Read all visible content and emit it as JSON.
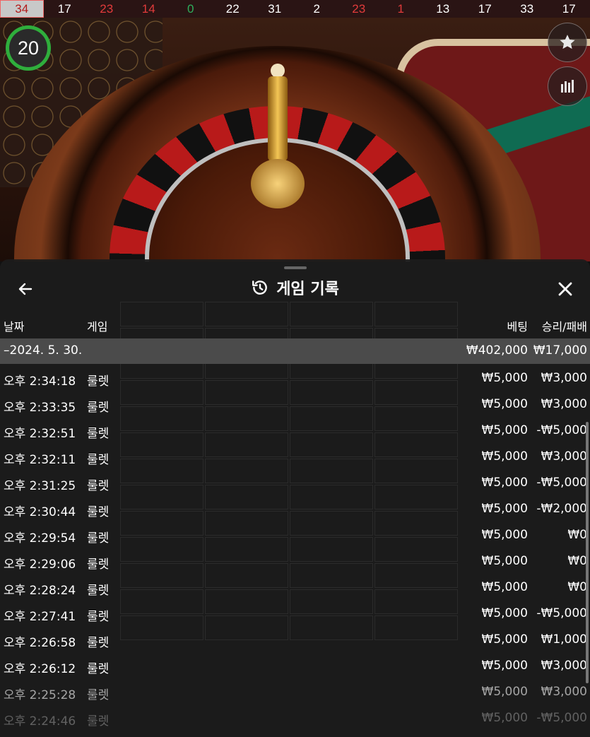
{
  "results_strip": [
    {
      "value": "34",
      "color": "#b31b1b",
      "highlight": true
    },
    {
      "value": "17",
      "color": "#ffffff"
    },
    {
      "value": "23",
      "color": "#e23b3b"
    },
    {
      "value": "14",
      "color": "#e23b3b"
    },
    {
      "value": "0",
      "color": "#2fae5c"
    },
    {
      "value": "22",
      "color": "#ffffff"
    },
    {
      "value": "31",
      "color": "#ffffff"
    },
    {
      "value": "2",
      "color": "#ffffff"
    },
    {
      "value": "23",
      "color": "#e23b3b"
    },
    {
      "value": "1",
      "color": "#e23b3b"
    },
    {
      "value": "13",
      "color": "#ffffff"
    },
    {
      "value": "17",
      "color": "#ffffff"
    },
    {
      "value": "33",
      "color": "#ffffff"
    },
    {
      "value": "17",
      "color": "#ffffff"
    }
  ],
  "timer": {
    "value": "20",
    "color": "#2fae3c"
  },
  "panel": {
    "title": "게임 기록",
    "back_icon": "arrow-left-icon",
    "history_icon": "history-icon",
    "close_icon": "close-icon"
  },
  "columns": {
    "date": "날짜",
    "game": "게임",
    "bet": "베팅",
    "win": "승리/패배"
  },
  "summary": {
    "date": "–2024. 5. 30.",
    "bet": "₩402,000",
    "win": "₩17,000"
  },
  "rows": [
    {
      "time": "오후 2:34:18",
      "game": "룰렛",
      "bet": "₩5,000",
      "win": "₩3,000"
    },
    {
      "time": "오후 2:33:35",
      "game": "룰렛",
      "bet": "₩5,000",
      "win": "₩3,000"
    },
    {
      "time": "오후 2:32:51",
      "game": "룰렛",
      "bet": "₩5,000",
      "win": "-₩5,000"
    },
    {
      "time": "오후 2:32:11",
      "game": "룰렛",
      "bet": "₩5,000",
      "win": "₩3,000"
    },
    {
      "time": "오후 2:31:25",
      "game": "룰렛",
      "bet": "₩5,000",
      "win": "-₩5,000"
    },
    {
      "time": "오후 2:30:44",
      "game": "룰렛",
      "bet": "₩5,000",
      "win": "-₩2,000"
    },
    {
      "time": "오후 2:29:54",
      "game": "룰렛",
      "bet": "₩5,000",
      "win": "₩0"
    },
    {
      "time": "오후 2:29:06",
      "game": "룰렛",
      "bet": "₩5,000",
      "win": "₩0"
    },
    {
      "time": "오후 2:28:24",
      "game": "룰렛",
      "bet": "₩5,000",
      "win": "₩0"
    },
    {
      "time": "오후 2:27:41",
      "game": "룰렛",
      "bet": "₩5,000",
      "win": "-₩5,000"
    },
    {
      "time": "오후 2:26:58",
      "game": "룰렛",
      "bet": "₩5,000",
      "win": "₩1,000"
    },
    {
      "time": "오후 2:26:12",
      "game": "룰렛",
      "bet": "₩5,000",
      "win": "₩3,000"
    },
    {
      "time": "오후 2:25:28",
      "game": "룰렛",
      "bet": "₩5,000",
      "win": "₩3,000"
    },
    {
      "time": "오후 2:24:46",
      "game": "룰렛",
      "bet": "₩5,000",
      "win": "-₩5,000"
    }
  ]
}
